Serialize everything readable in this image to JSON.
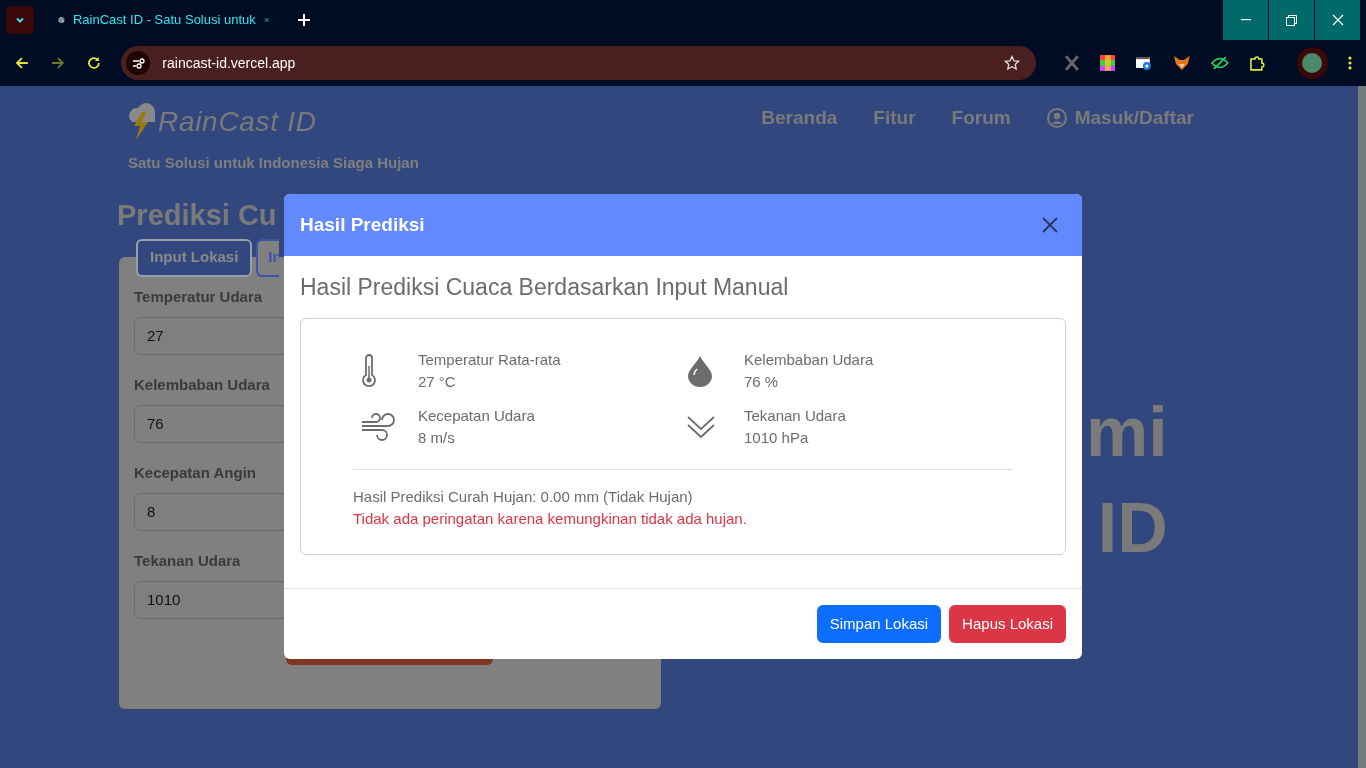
{
  "browser": {
    "tab_title": "RainCast ID - Satu Solusi untuk",
    "url": "raincast-id.vercel.app"
  },
  "site": {
    "logo": "RainCast ID",
    "tagline": "Satu Solusi untuk Indonesia Siaga Hujan",
    "nav": [
      {
        "label": "Beranda",
        "kind": "link"
      },
      {
        "label": "Fitur",
        "kind": "link"
      },
      {
        "label": "Forum",
        "kind": "link"
      },
      {
        "label": "Masuk/Daftar",
        "kind": "account"
      }
    ],
    "page_title": "Prediksi Cu",
    "tabs": [
      {
        "label": "Input Lokasi",
        "selected": true
      },
      {
        "label": "In",
        "selected": false
      }
    ],
    "fields": [
      {
        "label": "Temperatur Udara",
        "value": "27"
      },
      {
        "label": "Kelembaban Udara",
        "value": "76"
      },
      {
        "label": "Kecepatan Angin",
        "value": "8"
      },
      {
        "label": "Tekanan Udara",
        "value": "1010"
      }
    ],
    "hero_lines": [
      "mi",
      "ID"
    ]
  },
  "modal": {
    "title": "Hasil Prediksi",
    "heading": "Hasil Prediksi Cuaca Berdasarkan Input Manual",
    "stats": [
      {
        "kind": "temperature",
        "label": "Temperatur Rata-rata",
        "value": "27 °C"
      },
      {
        "kind": "humidity",
        "label": "Kelembaban Udara",
        "value": "76 %"
      },
      {
        "kind": "wind",
        "label": "Kecepatan Udara",
        "value": "8 m/s"
      },
      {
        "kind": "pressure",
        "label": "Tekanan Udara",
        "value": "1010 hPa"
      }
    ],
    "result": "Hasil Prediksi Curah Hujan: 0.00 mm (Tidak Hujan)",
    "warning": "Tidak ada peringatan karena kemungkinan tidak ada hujan.",
    "buttons": [
      {
        "label": "Simpan Lokasi",
        "kind": "primary"
      },
      {
        "label": "Hapus Lokasi",
        "kind": "danger"
      }
    ]
  }
}
